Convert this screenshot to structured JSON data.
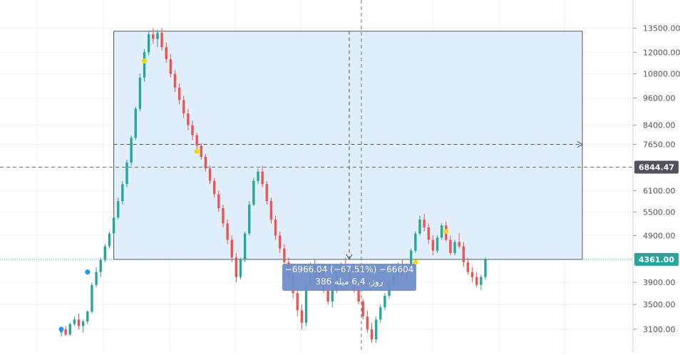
{
  "chart_data": {
    "type": "candlestick",
    "y_axis": {
      "position": "right",
      "scale": "log",
      "ticks": [
        "13500.00",
        "12000.00",
        "10800.00",
        "9600.00",
        "8400.00",
        "7650.00",
        "6100.00",
        "5500.00",
        "4900.00",
        "3900.00",
        "3500.00",
        "3100.00"
      ],
      "tick_values": [
        13500,
        12000,
        10800,
        9600,
        8400,
        7650,
        6100,
        5500,
        4900,
        3900,
        3500,
        3100
      ],
      "range": [
        2850,
        14500
      ]
    },
    "price_labels": [
      {
        "name": "crosshair-price",
        "value": "6844.47",
        "color": "#50535e"
      },
      {
        "name": "last-price",
        "value": "4361.00",
        "color": "#26a69a"
      }
    ],
    "measure_box": {
      "from_price": 13300,
      "to_price": 4361,
      "fill": "#dcebfc",
      "line1": "−6966.04 (−67.51%) −66604",
      "line2": "386 روز، 4‏,6 میله"
    },
    "colors": {
      "up": "#26a69a",
      "down": "#ef5350",
      "grid": "#eef0f3",
      "dot_yellow": "#f5d800",
      "dot_blue": "#2196f3"
    },
    "candles": [
      [
        3050,
        3120,
        2990,
        3100
      ],
      [
        3100,
        3150,
        3000,
        3020
      ],
      [
        3020,
        3200,
        3000,
        3180
      ],
      [
        3180,
        3300,
        3150,
        3250
      ],
      [
        3250,
        3350,
        3100,
        3150
      ],
      [
        3150,
        3250,
        3050,
        3220
      ],
      [
        3220,
        3400,
        3180,
        3380
      ],
      [
        3380,
        3900,
        3350,
        3850
      ],
      [
        3850,
        4200,
        3800,
        4100
      ],
      [
        4100,
        4400,
        4000,
        4350
      ],
      [
        4350,
        4700,
        4300,
        4650
      ],
      [
        4650,
        5000,
        4600,
        4950
      ],
      [
        4950,
        5400,
        4900,
        5350
      ],
      [
        5350,
        5900,
        5300,
        5800
      ],
      [
        5800,
        6400,
        5700,
        6300
      ],
      [
        6300,
        7100,
        6200,
        7000
      ],
      [
        7000,
        8000,
        6900,
        7900
      ],
      [
        7900,
        9200,
        7800,
        9100
      ],
      [
        9100,
        10800,
        9000,
        10600
      ],
      [
        10600,
        12200,
        10400,
        12000
      ],
      [
        12000,
        13300,
        11800,
        13100
      ],
      [
        13100,
        13500,
        12500,
        12800
      ],
      [
        12800,
        13400,
        12300,
        13200
      ],
      [
        13200,
        13500,
        12100,
        12300
      ],
      [
        12300,
        12600,
        11400,
        11600
      ],
      [
        11600,
        11900,
        10600,
        10800
      ],
      [
        10800,
        11000,
        9900,
        10100
      ],
      [
        10100,
        10300,
        9300,
        9500
      ],
      [
        9500,
        9700,
        8700,
        8900
      ],
      [
        8900,
        9100,
        8200,
        8400
      ],
      [
        8400,
        8600,
        7800,
        8000
      ],
      [
        8000,
        8100,
        7400,
        7600
      ],
      [
        7600,
        7700,
        7100,
        7200
      ],
      [
        7200,
        7300,
        6700,
        6800
      ],
      [
        6800,
        6900,
        6300,
        6400
      ],
      [
        6400,
        6500,
        5900,
        6000
      ],
      [
        6000,
        6100,
        5500,
        5600
      ],
      [
        5600,
        5700,
        5100,
        5200
      ],
      [
        5200,
        5300,
        4700,
        4800
      ],
      [
        4800,
        4900,
        4300,
        4400
      ],
      [
        4400,
        4500,
        3900,
        4000
      ],
      [
        4000,
        4400,
        3950,
        4350
      ],
      [
        4350,
        5000,
        4300,
        4950
      ],
      [
        4950,
        5800,
        4900,
        5700
      ],
      [
        5700,
        6500,
        5650,
        6400
      ],
      [
        6400,
        6800,
        6300,
        6700
      ],
      [
        6700,
        6900,
        6200,
        6300
      ],
      [
        6300,
        6400,
        5700,
        5800
      ],
      [
        5800,
        5900,
        5200,
        5300
      ],
      [
        5300,
        5400,
        4800,
        4900
      ],
      [
        4900,
        5000,
        4500,
        4600
      ],
      [
        4600,
        4700,
        4200,
        4300
      ],
      [
        4300,
        4400,
        3900,
        4000
      ],
      [
        4000,
        4100,
        3600,
        3700
      ],
      [
        3700,
        3800,
        3300,
        3400
      ],
      [
        3400,
        3500,
        3100,
        3200
      ],
      [
        3200,
        3900,
        3150,
        3850
      ],
      [
        3850,
        4300,
        3800,
        4250
      ],
      [
        4250,
        4350,
        3800,
        3850
      ],
      [
        3850,
        4200,
        3750,
        4150
      ],
      [
        4150,
        4250,
        3700,
        3750
      ],
      [
        3750,
        3900,
        3500,
        3550
      ],
      [
        3550,
        3800,
        3450,
        3750
      ],
      [
        3750,
        4100,
        3700,
        4050
      ],
      [
        4050,
        4300,
        4000,
        4250
      ],
      [
        4250,
        4400,
        4050,
        4100
      ],
      [
        4100,
        4200,
        3850,
        3900
      ],
      [
        3900,
        4000,
        3700,
        3750
      ],
      [
        3750,
        3800,
        3500,
        3550
      ],
      [
        3550,
        3600,
        3250,
        3300
      ],
      [
        3300,
        3400,
        3050,
        3100
      ],
      [
        3100,
        3200,
        2900,
        2950
      ],
      [
        2950,
        3300,
        2900,
        3250
      ],
      [
        3250,
        3500,
        3200,
        3450
      ],
      [
        3450,
        3700,
        3400,
        3650
      ],
      [
        3650,
        3900,
        3600,
        3850
      ],
      [
        3850,
        4100,
        3800,
        4050
      ],
      [
        4050,
        4300,
        3950,
        4250
      ],
      [
        4250,
        4350,
        4000,
        4050
      ],
      [
        4050,
        4250,
        3900,
        4200
      ],
      [
        4200,
        4600,
        4150,
        4550
      ],
      [
        4550,
        5000,
        4500,
        4950
      ],
      [
        4950,
        5400,
        4900,
        5300
      ],
      [
        5300,
        5450,
        5000,
        5100
      ],
      [
        5100,
        5200,
        4700,
        4800
      ],
      [
        4800,
        4900,
        4450,
        4550
      ],
      [
        4550,
        4900,
        4500,
        4850
      ],
      [
        4850,
        5200,
        4800,
        5150
      ],
      [
        5150,
        5250,
        4750,
        4800
      ],
      [
        4800,
        4900,
        4450,
        4500
      ],
      [
        4500,
        4800,
        4450,
        4750
      ],
      [
        4750,
        4950,
        4600,
        4650
      ],
      [
        4650,
        4750,
        4200,
        4300
      ],
      [
        4300,
        4400,
        4050,
        4100
      ],
      [
        4100,
        4200,
        3900,
        4000
      ],
      [
        4000,
        4100,
        3800,
        3850
      ],
      [
        3850,
        4050,
        3750,
        4000
      ],
      [
        4000,
        4400,
        3950,
        4361
      ]
    ],
    "markers": [
      {
        "index": 0,
        "price": 3100,
        "color": "blue"
      },
      {
        "index": 6,
        "price": 4100,
        "color": "blue"
      },
      {
        "index": 19,
        "price": 11500,
        "color": "yellow"
      },
      {
        "index": 31,
        "price": 7400,
        "color": "yellow"
      },
      {
        "index": 81,
        "price": 4300,
        "color": "yellow"
      },
      {
        "index": 88,
        "price": 5000,
        "color": "yellow"
      }
    ]
  }
}
